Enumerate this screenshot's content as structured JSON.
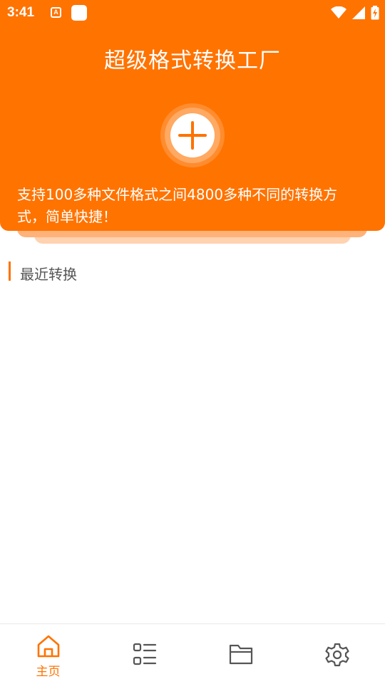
{
  "status_bar": {
    "time": "3:41",
    "app_icon_letter": "A",
    "icons": [
      "wifi-icon",
      "signal-icon",
      "battery-charging-icon"
    ]
  },
  "header": {
    "title": "超级格式转换工厂",
    "add_button_icon": "plus-icon",
    "description": "支持100多种文件格式之间4800多种不同的转换方式，简单快捷！"
  },
  "recent": {
    "title": "最近转换"
  },
  "bottom_nav": {
    "active_color": "#FF7300",
    "inactive_color": "#555555",
    "items": [
      {
        "icon": "home-icon",
        "label": "主页",
        "active": true
      },
      {
        "icon": "list-icon",
        "label": "",
        "active": false
      },
      {
        "icon": "folder-icon",
        "label": "",
        "active": false
      },
      {
        "icon": "settings-gear-icon",
        "label": "",
        "active": false
      }
    ]
  },
  "colors": {
    "brand": "#FF7300"
  }
}
